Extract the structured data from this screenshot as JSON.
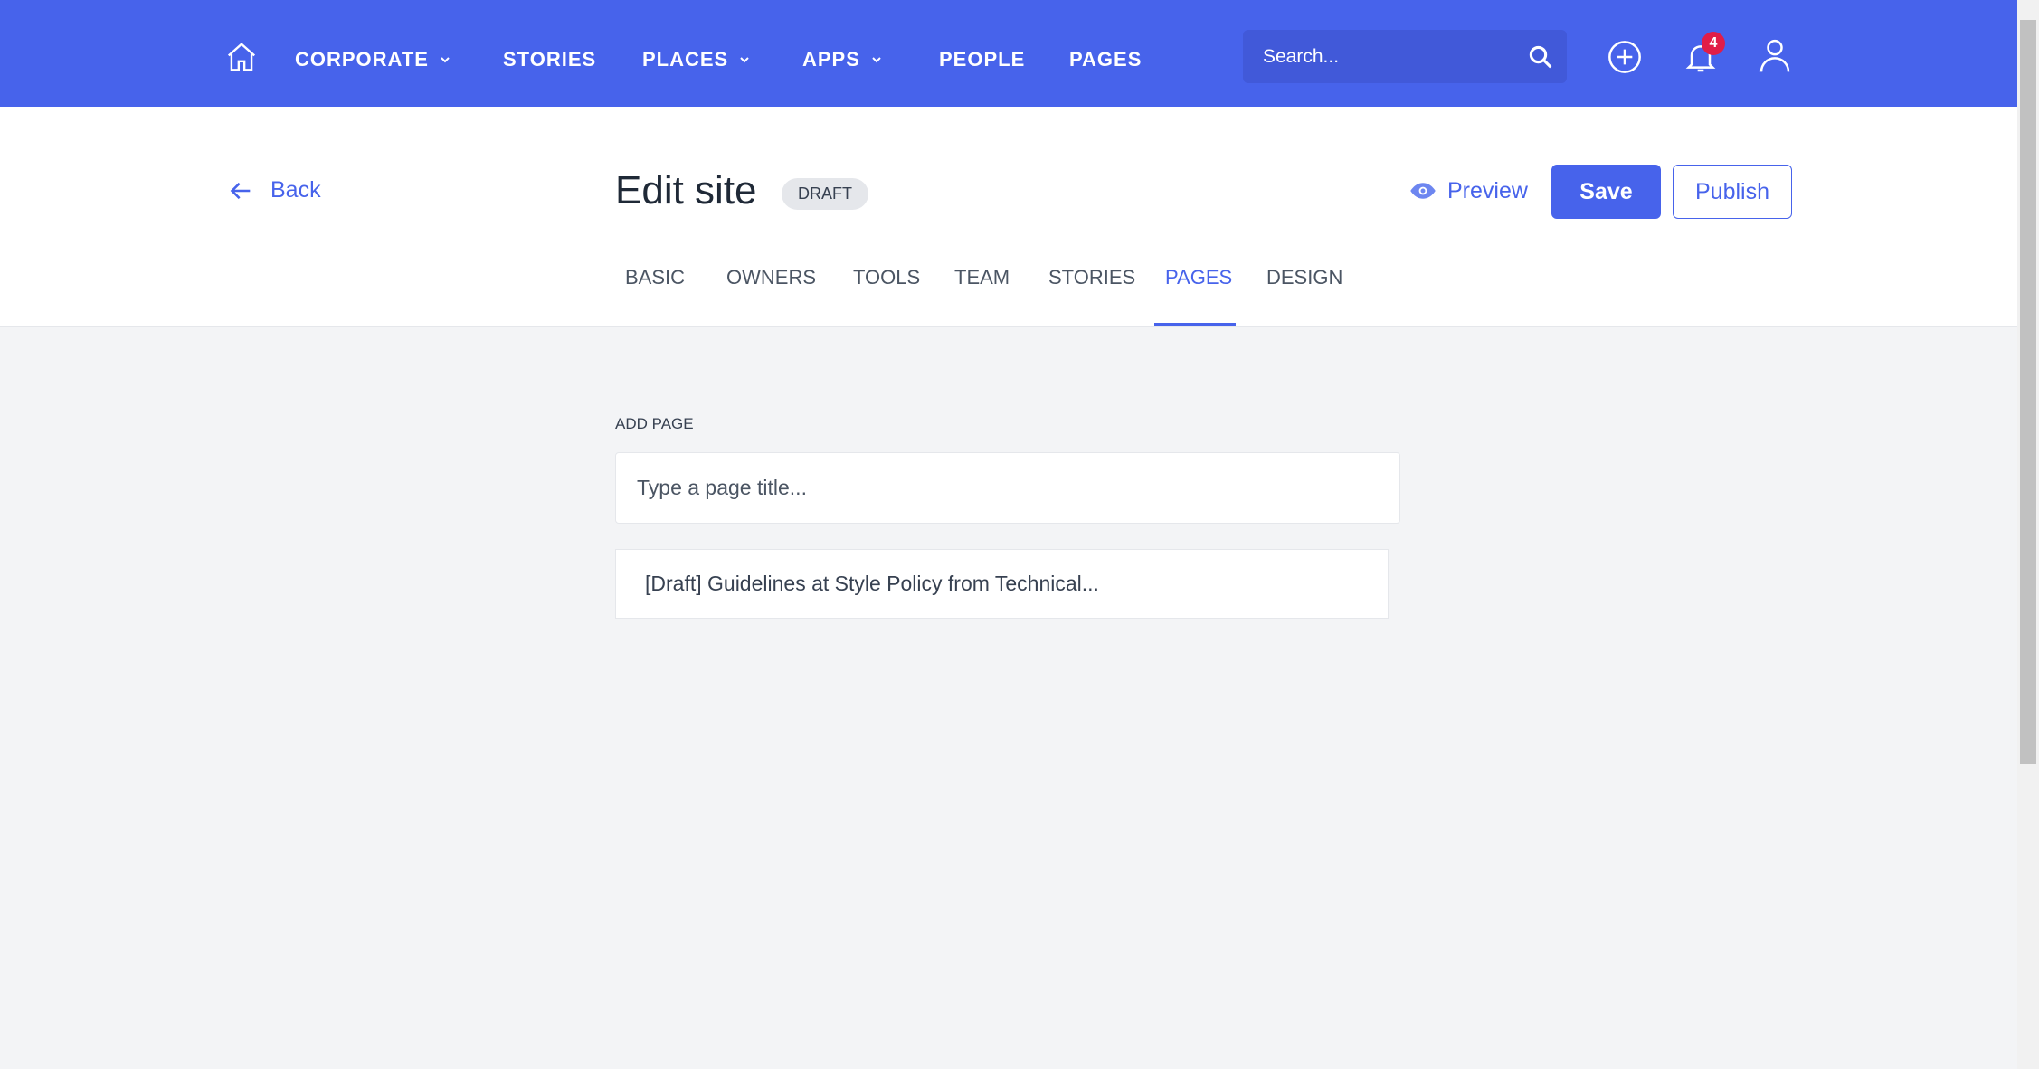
{
  "nav": {
    "items": [
      {
        "label": "CORPORATE",
        "dropdown": true
      },
      {
        "label": "STORIES",
        "dropdown": false
      },
      {
        "label": "PLACES",
        "dropdown": true
      },
      {
        "label": "APPS",
        "dropdown": true
      },
      {
        "label": "PEOPLE",
        "dropdown": false
      },
      {
        "label": "PAGES",
        "dropdown": false
      }
    ],
    "search_placeholder": "Search...",
    "notification_count": "4"
  },
  "header": {
    "back_label": "Back",
    "title": "Edit site",
    "status_badge": "DRAFT",
    "preview_label": "Preview",
    "save_label": "Save",
    "publish_label": "Publish"
  },
  "tabs": [
    {
      "label": "BASIC"
    },
    {
      "label": "OWNERS"
    },
    {
      "label": "TOOLS"
    },
    {
      "label": "TEAM"
    },
    {
      "label": "STORIES"
    },
    {
      "label": "PAGES",
      "active": true
    },
    {
      "label": "DESIGN"
    }
  ],
  "main": {
    "add_page_label": "ADD PAGE",
    "page_title_placeholder": "Type a page title...",
    "pages": [
      {
        "title": "[Draft]  Guidelines at Style Policy from Technical..."
      }
    ]
  },
  "colors": {
    "brand": "#4763eb",
    "badge": "#e11d48"
  }
}
